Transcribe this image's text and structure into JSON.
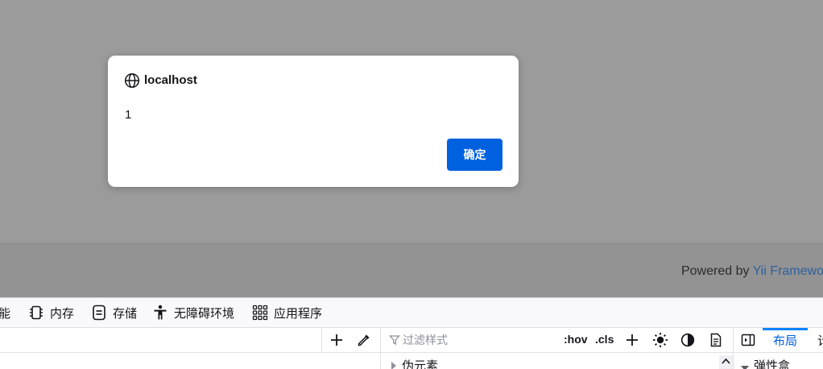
{
  "page": {
    "footer_prefix": "Powered by ",
    "footer_link": "Yii Framework"
  },
  "dialog": {
    "origin": "localhost",
    "message": "1",
    "ok_label": "确定",
    "globe_icon": "globe-icon"
  },
  "devtools": {
    "tabs": [
      {
        "label": "能",
        "icon": "performance-icon"
      },
      {
        "label": "内存",
        "icon": "memory-icon"
      },
      {
        "label": "存储",
        "icon": "storage-icon"
      },
      {
        "label": "无障碍环境",
        "icon": "accessibility-icon"
      },
      {
        "label": "应用程序",
        "icon": "application-icon"
      }
    ],
    "rules_toolbar": {
      "filter_placeholder": "过滤样式",
      "hov_label": ":hov",
      "cls_label": ".cls"
    },
    "side_tabs": {
      "layout_label": "布局",
      "next_label": "计"
    },
    "rules_row": "伪元素",
    "layout_row": "弹性盒"
  },
  "colors": {
    "accent": "#0061e0",
    "overlay": "#9b9b9c",
    "link": "#2f5f98"
  }
}
